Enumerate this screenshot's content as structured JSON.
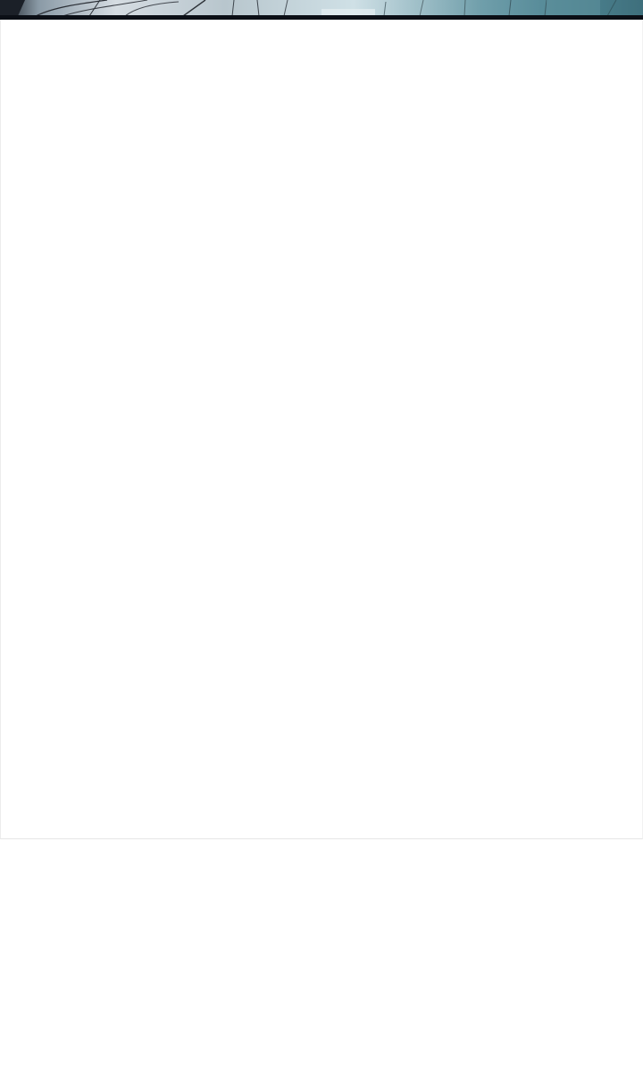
{
  "artwork": {
    "description_icon": "manga-panel-art",
    "colors": {
      "sky_light": "#c9dde6",
      "sky_teal": "#5f8f9c",
      "deep_teal": "#2f5b66",
      "frame_dark": "#0b0f16"
    }
  },
  "content": {},
  "footer": {}
}
